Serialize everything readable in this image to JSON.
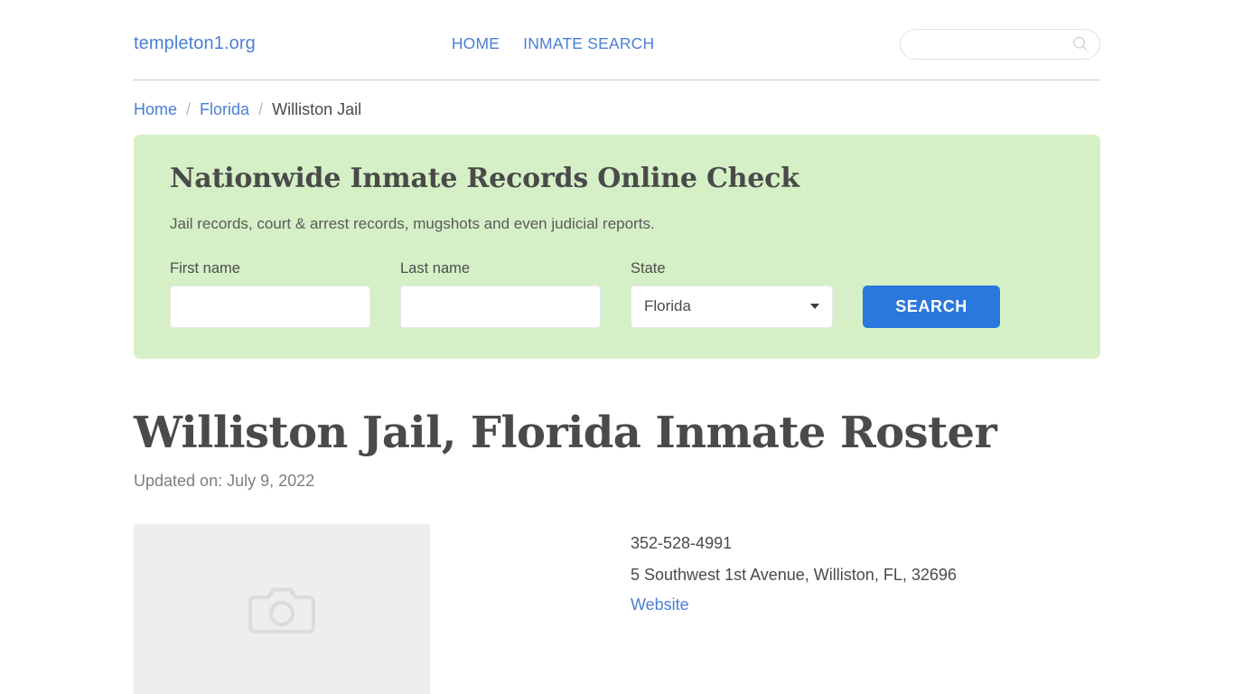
{
  "header": {
    "brand": "templeton1.org",
    "nav": [
      {
        "label": "HOME",
        "name": "nav-home"
      },
      {
        "label": "INMATE SEARCH",
        "name": "nav-inmate-search"
      }
    ],
    "search": {
      "value": "",
      "placeholder": ""
    }
  },
  "breadcrumb": {
    "home": "Home",
    "state": "Florida",
    "current": "Williston Jail",
    "separator": "/"
  },
  "promo": {
    "title": "Nationwide Inmate Records Online Check",
    "subtitle": "Jail records, court & arrest records, mugshots and even judicial reports.",
    "fields": {
      "first_name_label": "First name",
      "first_name_value": "",
      "first_name_placeholder": "",
      "last_name_label": "Last name",
      "last_name_value": "",
      "last_name_placeholder": "",
      "state_label": "State",
      "state_value": "Florida"
    },
    "search_button": "SEARCH",
    "background_color": "#d5f0c6",
    "button_color": "#2a77dd"
  },
  "main": {
    "title": "Williston Jail, Florida Inmate Roster",
    "updated": "Updated on: July 9, 2022",
    "facility": {
      "phone": "352-528-4991",
      "address": "5 Southwest 1st Avenue, Williston, FL, 32696",
      "website_label": "Website",
      "photo_placeholder_icon": "camera-icon"
    }
  },
  "colors": {
    "link": "#4a7fd4",
    "text": "#4a4a4a",
    "muted": "#7e7e7e"
  }
}
